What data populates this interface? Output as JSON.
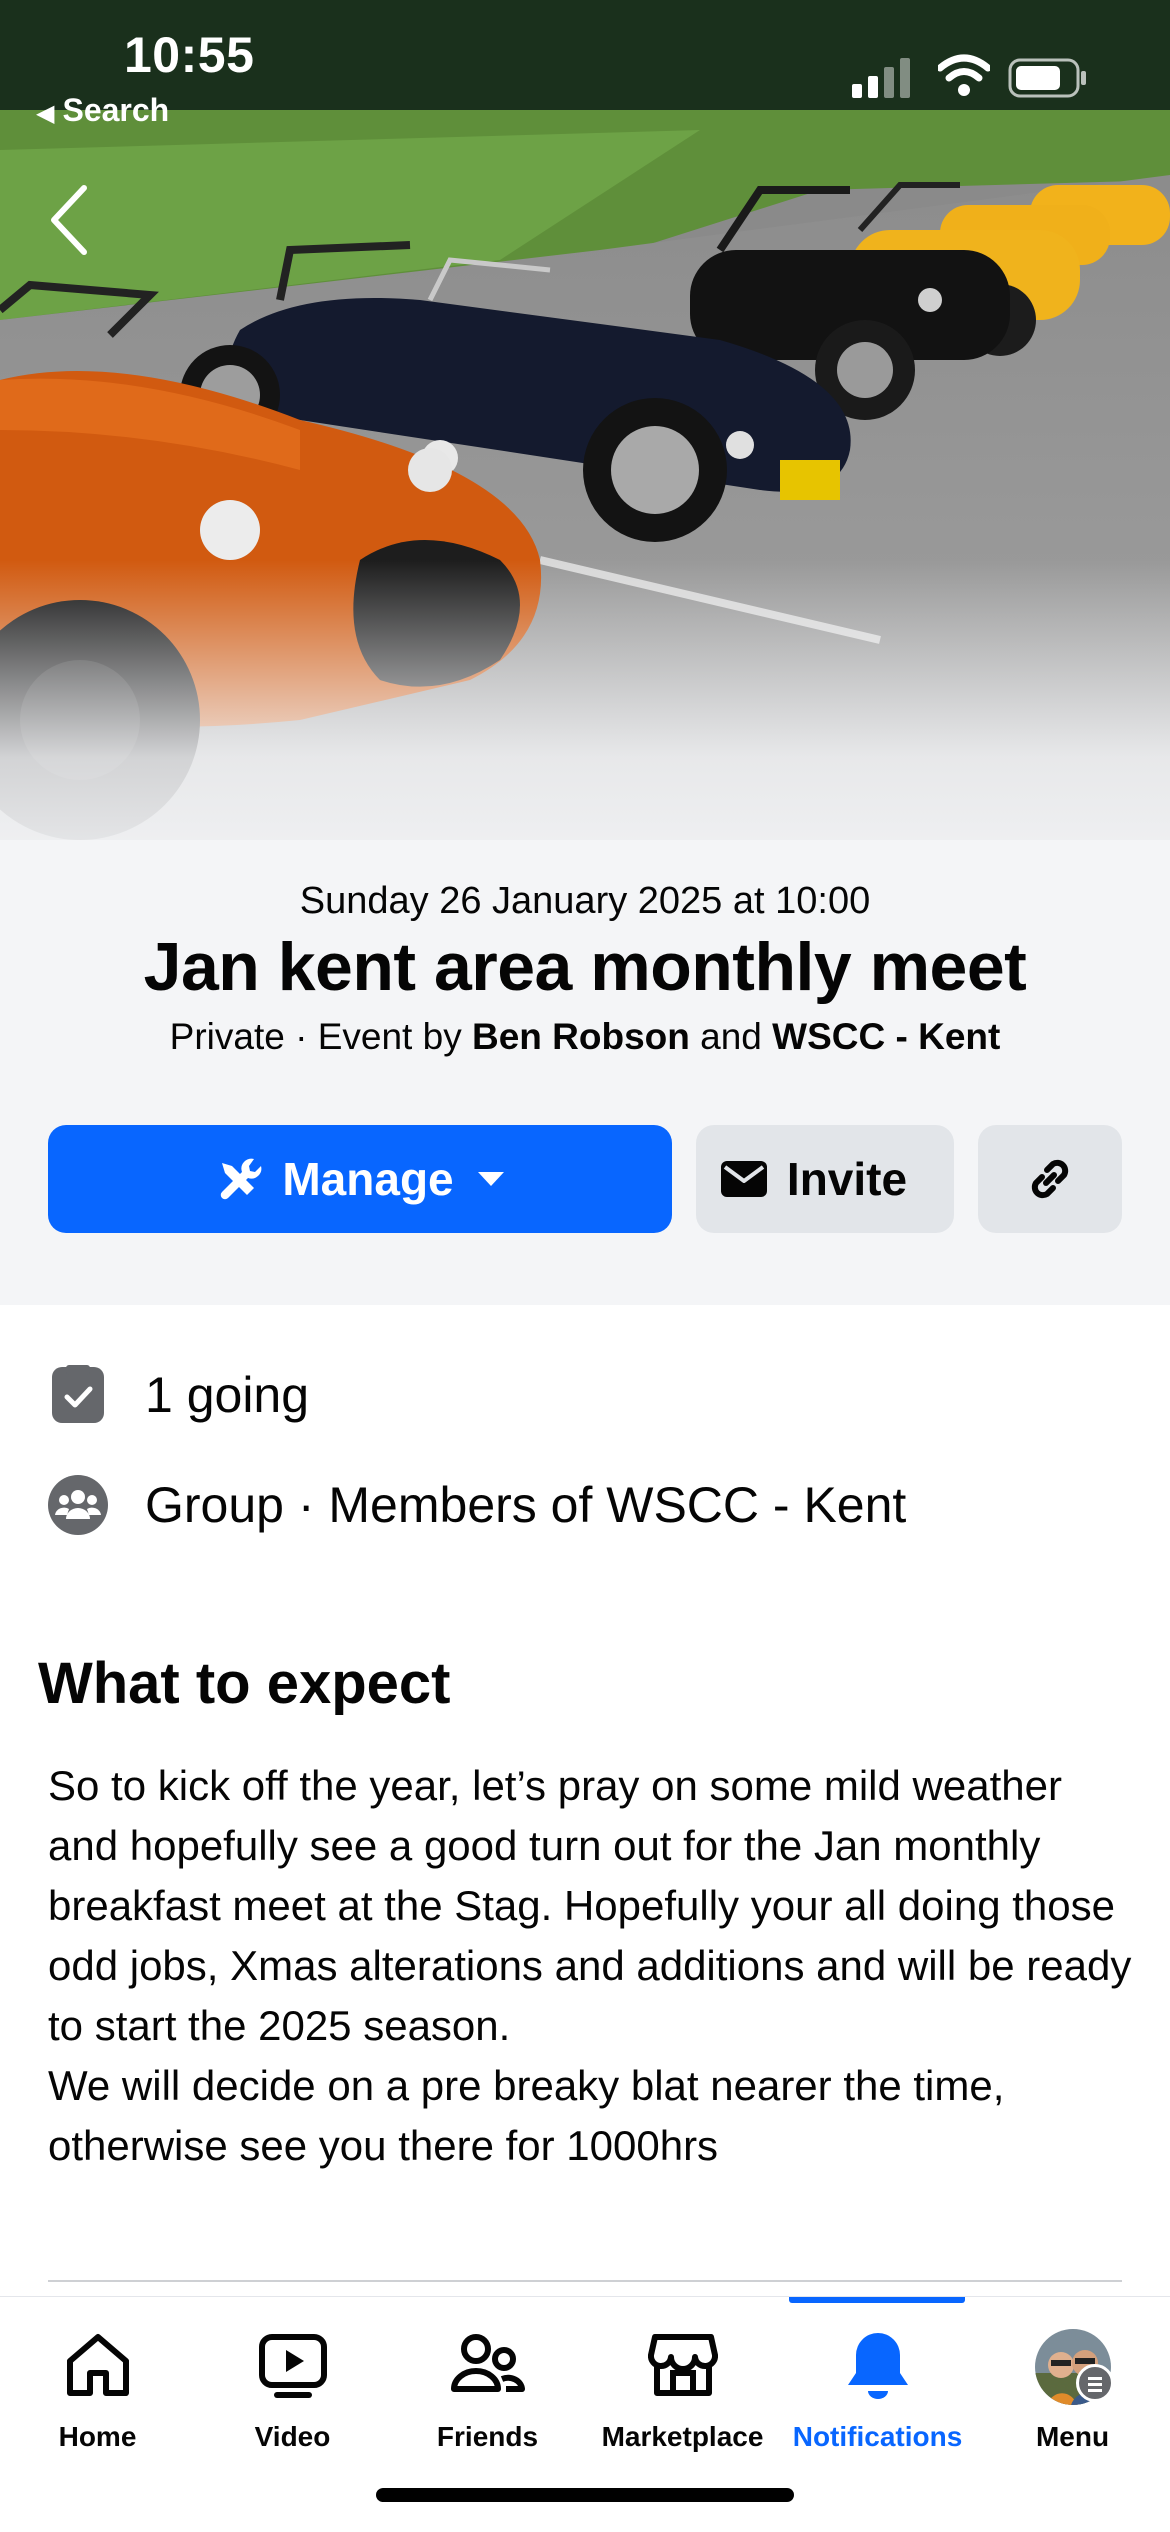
{
  "status_bar": {
    "time": "10:55",
    "back_app_label": "Search"
  },
  "event": {
    "date": "Sunday 26 January 2025 at 10:00",
    "title": "Jan kent area monthly meet",
    "privacy": "Private",
    "byline_prefix": "Event by",
    "host1": "Ben Robson",
    "and": "and",
    "host2": "WSCC - Kent"
  },
  "actions": {
    "manage_label": "Manage",
    "invite_label": "Invite"
  },
  "info": {
    "going": "1 going",
    "group": "Group · Members of WSCC - Kent"
  },
  "details": {
    "heading": "What to expect",
    "text": "So to kick off the year, let’s pray on some mild weather and hopefully see a good turn out for the Jan monthly breakfast meet at the Stag. Hopefully your all doing those odd jobs, Xmas alterations and additions and will be ready to start the 2025 season.\nWe will decide on a pre breaky blat nearer the time, otherwise see you there for 1000hrs"
  },
  "nav": {
    "items": [
      {
        "label": "Home",
        "icon": "home-icon"
      },
      {
        "label": "Video",
        "icon": "video-icon"
      },
      {
        "label": "Friends",
        "icon": "friends-icon"
      },
      {
        "label": "Marketplace",
        "icon": "marketplace-icon"
      },
      {
        "label": "Notifications",
        "icon": "bell-icon",
        "active": true
      },
      {
        "label": "Menu",
        "icon": "avatar"
      }
    ]
  },
  "colors": {
    "accent": "#0866ff",
    "button_secondary": "#e2e5e9",
    "header_bg": "#f4f5f7"
  }
}
